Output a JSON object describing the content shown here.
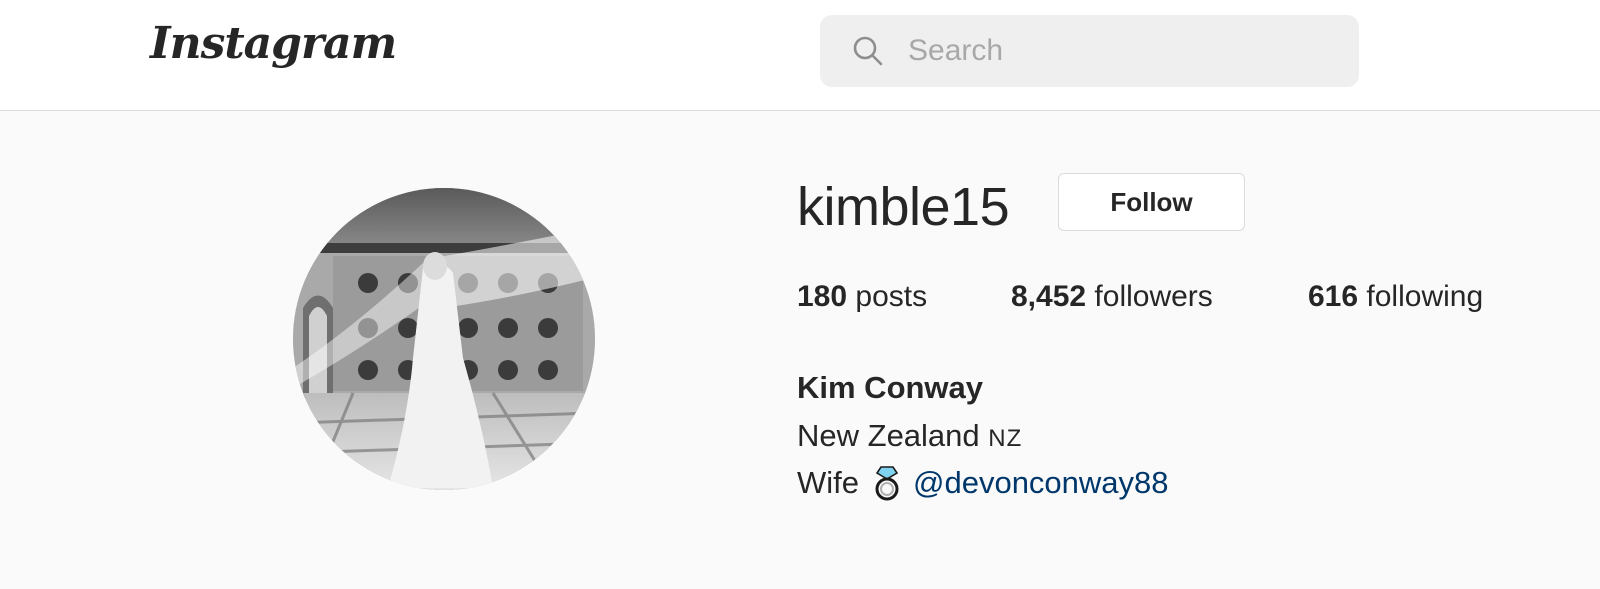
{
  "header": {
    "logo_text": "Instagram",
    "search": {
      "placeholder": "Search",
      "icon": "search-icon"
    }
  },
  "profile": {
    "username": "kimble15",
    "follow_label": "Follow",
    "stats": {
      "posts_count": "180",
      "posts_label": "posts",
      "followers_count": "8,452",
      "followers_label": "followers",
      "following_count": "616",
      "following_label": "following"
    },
    "full_name": "Kim Conway",
    "bio": {
      "location": "New Zealand",
      "flag": "NZ",
      "role": "Wife",
      "icon": "ring-icon",
      "mention": "@devonconway88"
    }
  },
  "colors": {
    "link": "#00376b",
    "page_background": "#fafafa",
    "header_background": "#ffffff",
    "border": "#dbdbdb"
  }
}
